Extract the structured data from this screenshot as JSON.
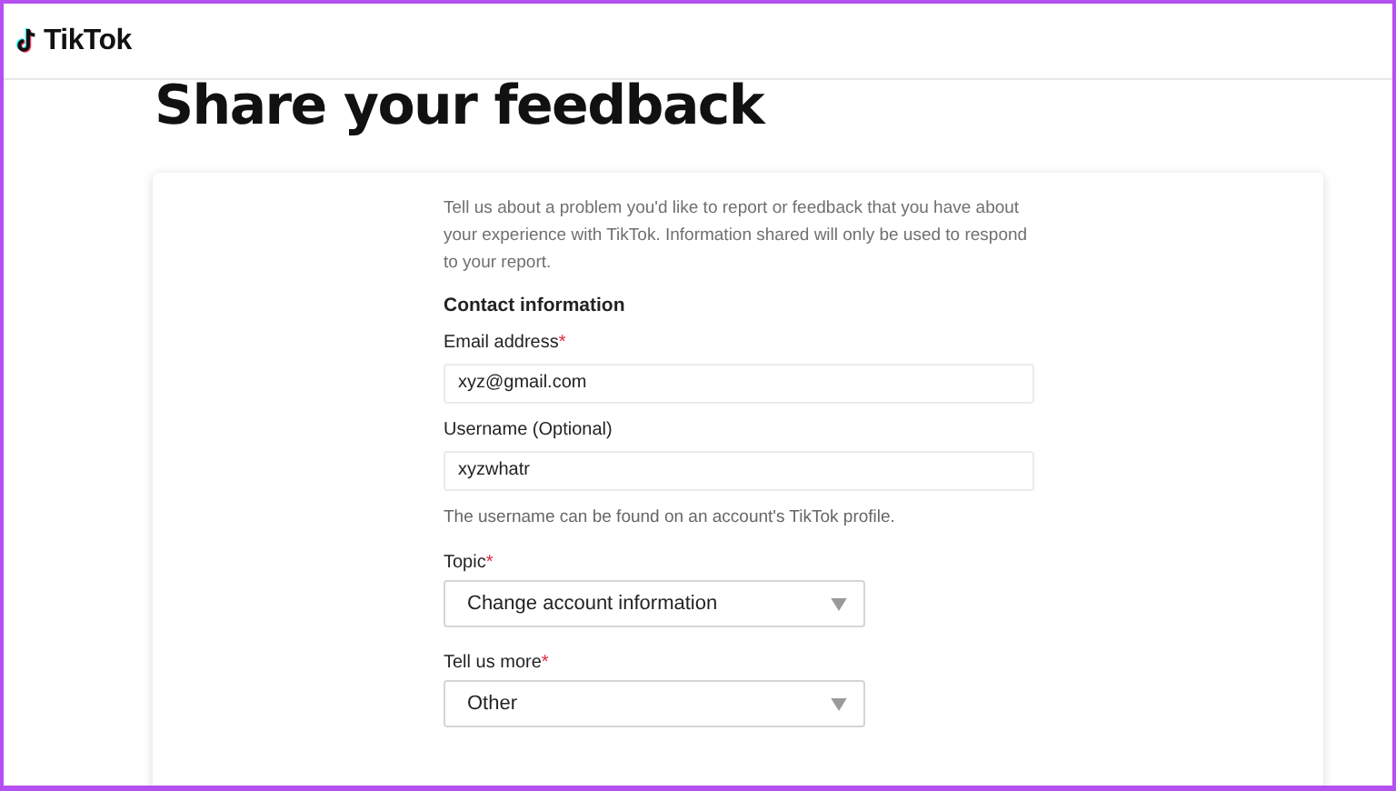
{
  "header": {
    "logo": "TikTok"
  },
  "title": "Share your feedback",
  "intro": "Tell us about a problem you'd like to report or feedback that you have about your experience with TikTok. Information shared will only be used to respond to your report.",
  "section": "Contact information",
  "fields": [
    {
      "kind": "text",
      "label": "Email address",
      "required_mark": "*",
      "value": "xyz@gmail.com"
    },
    {
      "kind": "text",
      "label": "Username (Optional)",
      "value": "xyzwhatr",
      "hint": "The username can be found on an account's TikTok profile."
    },
    {
      "kind": "select",
      "label": "Topic",
      "required_mark": "*",
      "value": "Change account information"
    },
    {
      "kind": "select",
      "label": "Tell us more",
      "required_mark": "*",
      "value": "Other"
    }
  ]
}
